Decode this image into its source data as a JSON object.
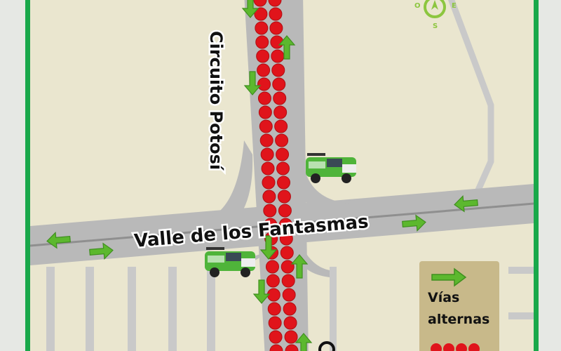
{
  "map": {
    "streets": {
      "vertical": "Circuito Potosí",
      "horizontal": "Valle de los Fantasmas"
    },
    "compass": {
      "west": "O",
      "east": "E",
      "south": "S"
    },
    "legend": {
      "alt_routes_line1": "Vías",
      "alt_routes_line2": "alternas"
    },
    "colors": {
      "background": "#eae6cf",
      "road": "#b9b9b9",
      "road_center": "#8f8f8f",
      "closure": "#e0141b",
      "arrow": "#5cb82e",
      "frame": "#19a84a",
      "legend_box": "#c8b98a"
    },
    "icons": [
      "police-truck-icon",
      "compass-icon",
      "alternate-route-arrow-icon",
      "closure-marker-icon"
    ]
  }
}
